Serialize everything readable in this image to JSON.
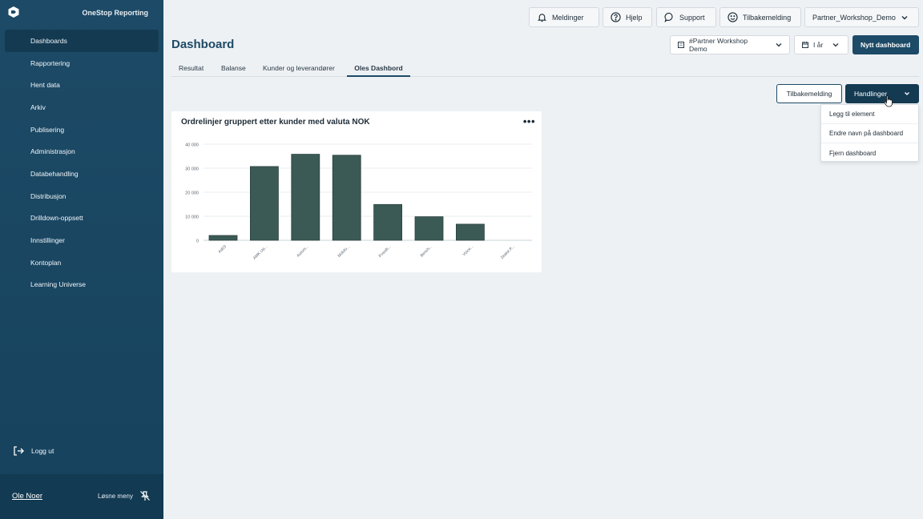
{
  "app": {
    "brand": "OneStop Reporting"
  },
  "sidebar": {
    "items": [
      {
        "label": "Dashboards",
        "active": true
      },
      {
        "label": "Rapportering"
      },
      {
        "label": "Hent data"
      },
      {
        "label": "Arkiv"
      },
      {
        "label": "Publisering"
      },
      {
        "label": "Administrasjon"
      },
      {
        "label": "Databehandling"
      },
      {
        "label": "Distribusjon"
      },
      {
        "label": "Drilldown-oppsett"
      },
      {
        "label": "Innstillinger"
      },
      {
        "label": "Kontoplan"
      },
      {
        "label": "Learning Universe"
      }
    ],
    "logout": "Logg ut",
    "user": "Ole Noer",
    "unpin": "Løsne meny"
  },
  "topbar": {
    "notifications": "Meldinger",
    "help": "Hjelp",
    "support": "Support",
    "feedback": "Tilbakemelding",
    "workspace": "Partner_Workshop_Demo"
  },
  "page": {
    "title": "Dashboard",
    "company_filter": "#Partner Workshop Demo",
    "period_filter": "I år",
    "new_dashboard": "Nytt dashboard"
  },
  "tabs": [
    "Resultat",
    "Balanse",
    "Kunder og leverandører",
    "Oles Dashbord"
  ],
  "actions": {
    "feedback": "Tilbakemelding",
    "handlinger": "Handlinger",
    "menu": [
      "Legg til element",
      "Endre navn på dashboard",
      "Fjern dashboard"
    ]
  },
  "widget": {
    "title": "Ordrelinjer gruppert etter kunder med valuta NOK",
    "more": "•••"
  },
  "colors": {
    "sidebar": "#1d4a66",
    "accent": "#1d4a66",
    "bar": "#3b5a55"
  },
  "chart_data": {
    "type": "bar",
    "categories": [
      "Ad03",
      "AMK Up...",
      "Autom...",
      "Mobilo...",
      "Possib...",
      "Bench...",
      "Voice...",
      "Zealot P..."
    ],
    "values": [
      2000,
      30700,
      35800,
      35400,
      14900,
      9800,
      6700,
      0
    ],
    "ylim": [
      0,
      40000
    ],
    "yticks": [
      0,
      10000,
      20000,
      30000,
      40000
    ],
    "ytick_labels": [
      "0",
      "10 000",
      "20 000",
      "30 000",
      "40 000"
    ],
    "grid": true
  }
}
